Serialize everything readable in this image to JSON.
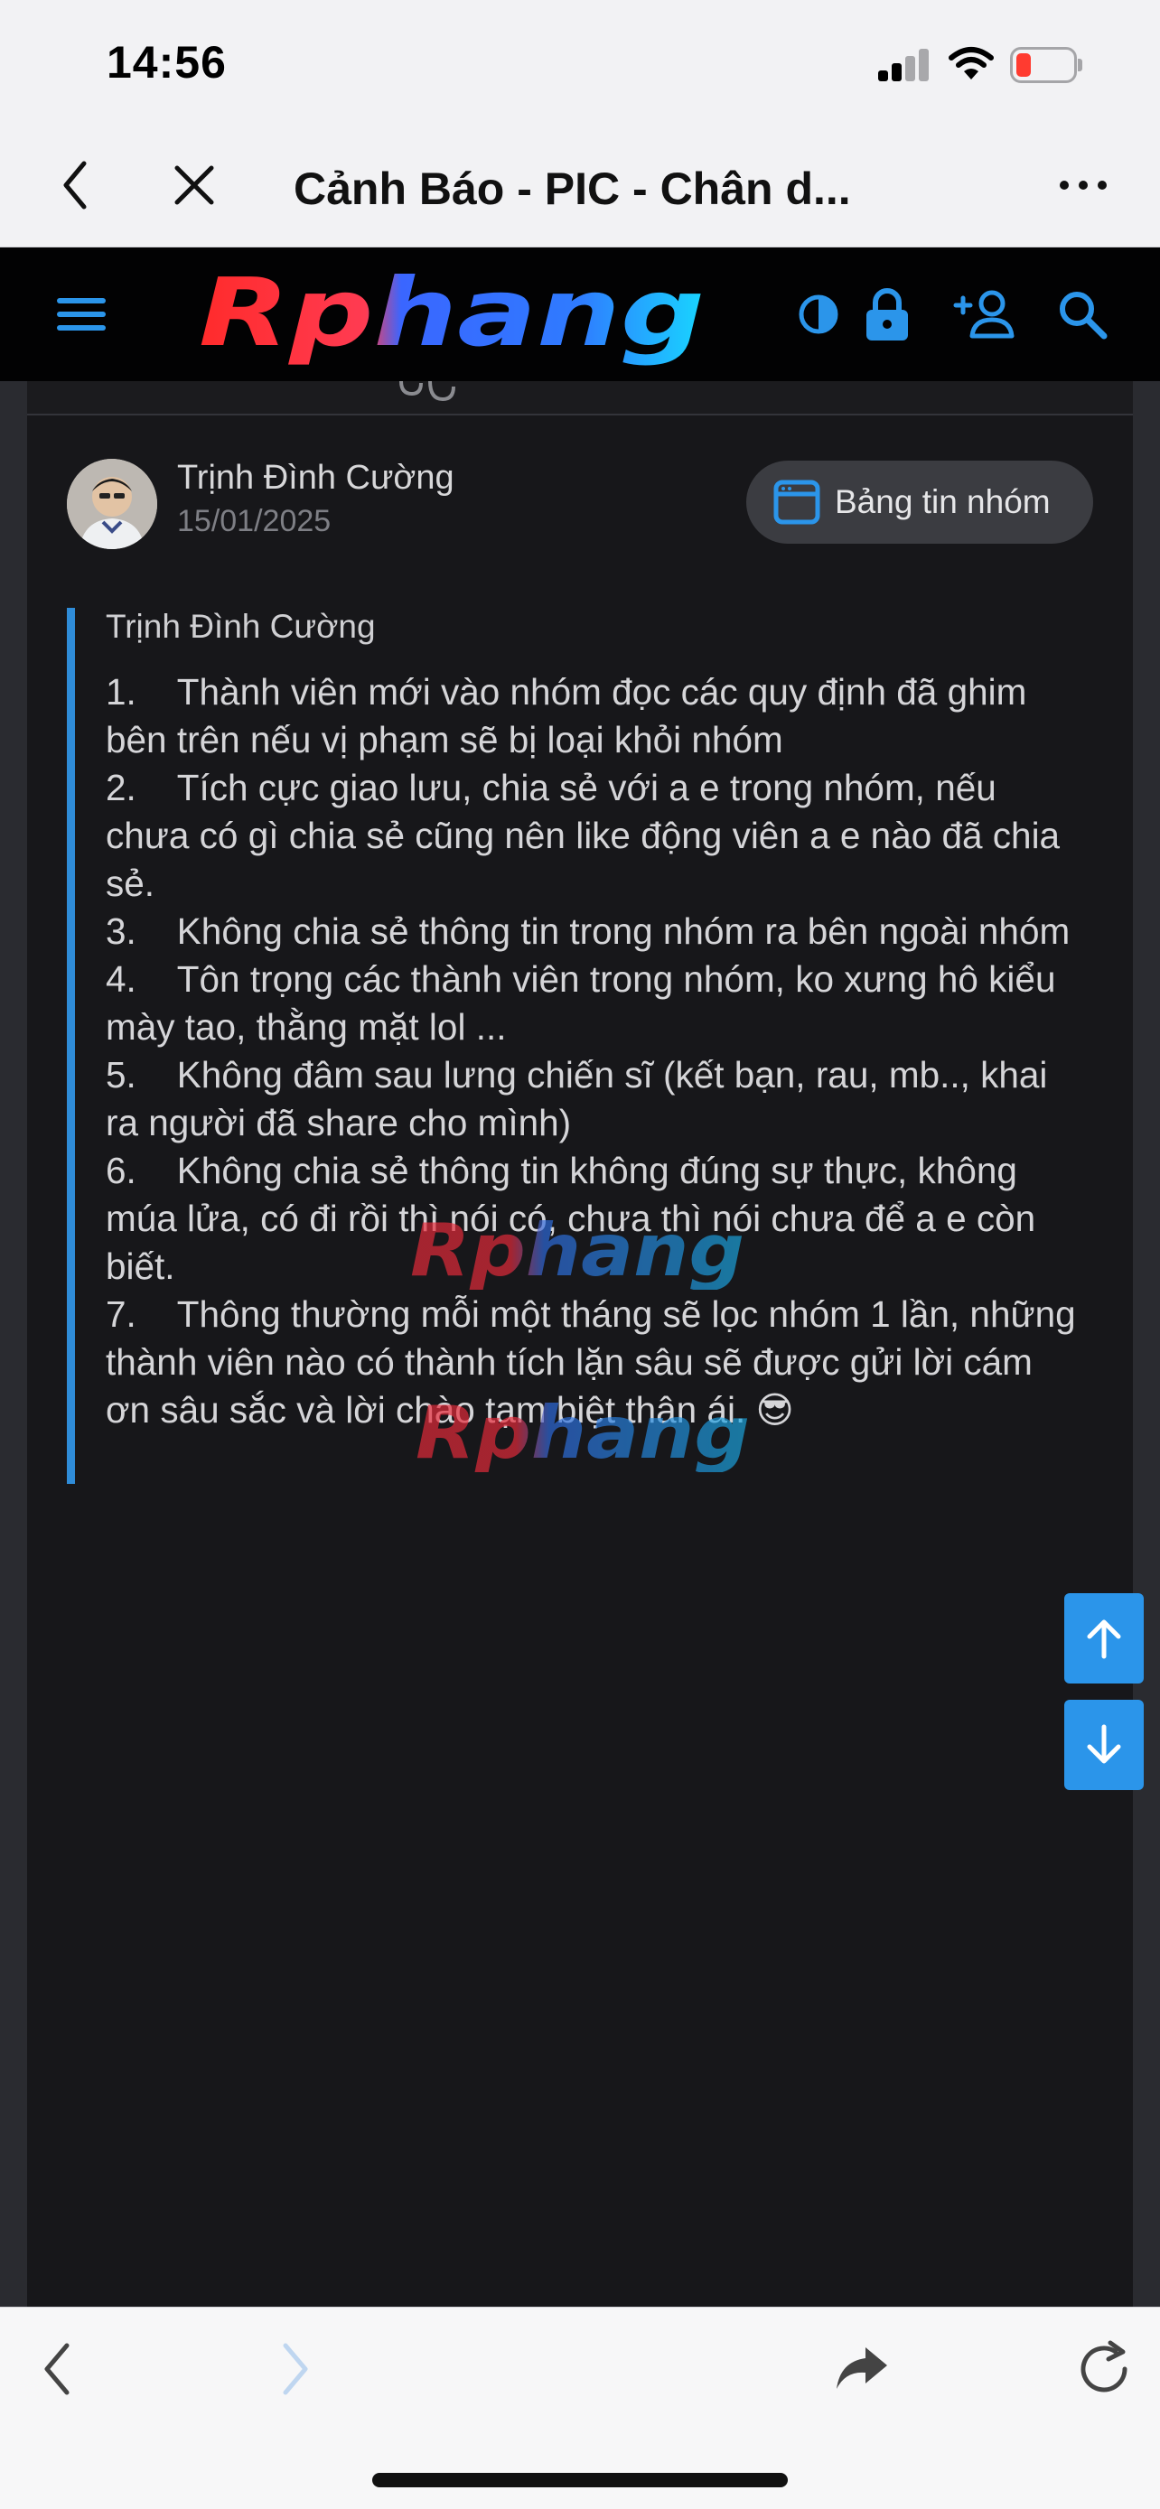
{
  "status_bar": {
    "time": "14:56",
    "battery_color": "#ff3b30"
  },
  "browser": {
    "title": "Cảnh Báo - PIC - Chân d...",
    "back_icon": "chevron-left-icon",
    "close_icon": "close-icon",
    "more_icon": "more-horizontal-icon"
  },
  "site_header": {
    "logo_text": "Rphang",
    "icons": [
      "menu-icon",
      "theme-toggle-icon",
      "lock-icon",
      "add-user-icon",
      "search-icon"
    ],
    "accent": "#2b95ea"
  },
  "post": {
    "author": "Trịnh Đình Cường",
    "date": "15/01/2025",
    "group_button": "Bảng tin nhóm",
    "quote_author": "Trịnh Đình Cường",
    "rules": [
      "1.    Thành viên mới vào nhóm đọc các quy định đã ghim bên trên nếu vị phạm sẽ bị loại khỏi nhóm",
      "2.    Tích cực giao lưu, chia sẻ với a e trong nhóm, nếu chưa có gì chia sẻ cũng nên like động viên a e nào đã chia sẻ.",
      "3.    Không chia sẻ thông tin trong nhóm ra bên ngoài nhóm",
      "4.    Tôn trọng các thành viên trong nhóm, ko xưng hô kiểu mày tao, thằng mặt lol ...",
      "5.    Không đâm sau lưng chiến sĩ (kết bạn, rau, mb.., khai ra người đã share cho mình)",
      "6.    Không chia sẻ thông tin không đúng sự thực, không múa lửa,  có đi rồi thì nói có, chưa thì nói chưa để a e còn biết.",
      "7.    Thông thường mỗi một tháng sẽ lọc nhóm 1 lần, những thành viên nào có thành tích lặn sâu sẽ được gửi lời cám ơn sâu sắc và lời chào tạm biệt thân ái. 😎"
    ]
  },
  "scroll_controls": {
    "up_icon": "arrow-up-icon",
    "down_icon": "arrow-down-icon"
  },
  "toolbar": {
    "icons": [
      "back-icon",
      "forward-icon",
      "share-icon",
      "reload-icon"
    ]
  }
}
